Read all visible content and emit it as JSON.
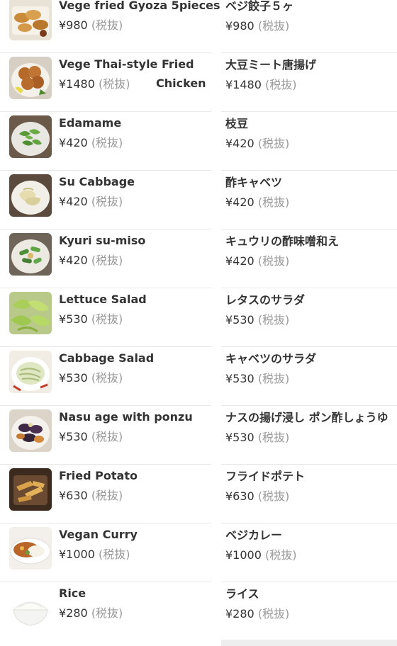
{
  "tax_label": "(税抜)",
  "left_items": [
    {
      "name": "Vege fried Gyoza 5pieces",
      "price": "¥980",
      "thumb": "gyoza-photo"
    },
    {
      "name": "Vege Thai-style Fried",
      "name_cont": "Chicken",
      "price": "¥1480",
      "thumb": "fried-chicken-photo"
    },
    {
      "name": "Edamame",
      "price": "¥420",
      "thumb": "edamame-photo"
    },
    {
      "name": "Su Cabbage",
      "price": "¥420",
      "thumb": "su-cabbage-photo"
    },
    {
      "name": "Kyuri su-miso",
      "price": "¥420",
      "thumb": "kyuri-photo"
    },
    {
      "name": "Lettuce Salad",
      "price": "¥530",
      "thumb": "lettuce-salad-photo"
    },
    {
      "name": "Cabbage Salad",
      "price": "¥530",
      "thumb": "cabbage-salad-photo"
    },
    {
      "name": "Nasu age with ponzu",
      "price": "¥530",
      "thumb": "nasu-photo"
    },
    {
      "name": "Fried  Potato",
      "price": "¥630",
      "thumb": "potato-photo"
    },
    {
      "name": "Vegan Curry",
      "price": "¥1000",
      "thumb": "curry-photo"
    },
    {
      "name": "Rice",
      "price": "¥280",
      "thumb": "rice-photo"
    }
  ],
  "right_items": [
    {
      "name": "ベジ餃子５ヶ",
      "price": "¥980"
    },
    {
      "name": "大豆ミート唐揚げ",
      "price": "¥1480"
    },
    {
      "name": "枝豆",
      "price": "¥420"
    },
    {
      "name": "酢キャベツ",
      "price": "¥420"
    },
    {
      "name": "キュウリの酢味噌和え",
      "price": "¥420"
    },
    {
      "name": "レタスのサラダ",
      "price": "¥530"
    },
    {
      "name": "キャベツのサラダ",
      "price": "¥530"
    },
    {
      "name": "ナスの揚げ浸し ポン酢しょうゆ",
      "price": "¥530"
    },
    {
      "name": "フライドポテト",
      "price": "¥630"
    },
    {
      "name": "ベジカレー",
      "price": "¥1000"
    },
    {
      "name": "ライス",
      "price": "¥280"
    }
  ]
}
